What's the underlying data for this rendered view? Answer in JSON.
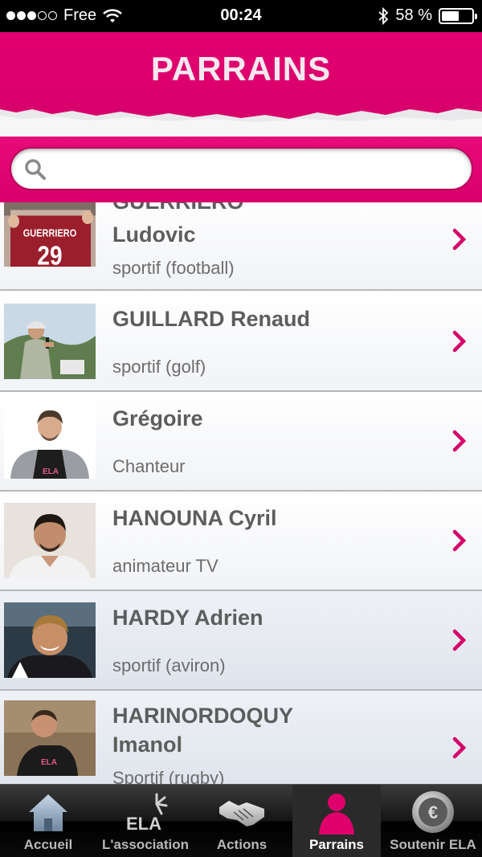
{
  "status_bar": {
    "carrier": "Free",
    "time": "00:24",
    "battery_percent": "58 %",
    "battery_level": 0.58,
    "signal_bars_filled": 3,
    "signal_bars_total": 5
  },
  "header": {
    "title": "PARRAINS"
  },
  "search": {
    "placeholder": "",
    "value": ""
  },
  "list": {
    "items": [
      {
        "name_line1": "GUERRIERO",
        "name_line2": "Ludovic",
        "subtitle": "sportif (football)"
      },
      {
        "name_line1": "GUILLARD  Renaud",
        "subtitle": "sportif (golf)"
      },
      {
        "name_line1": "Grégoire",
        "subtitle": "Chanteur"
      },
      {
        "name_line1": "HANOUNA Cyril",
        "subtitle": "animateur TV"
      },
      {
        "name_line1": "HARDY Adrien",
        "subtitle": "sportif (aviron)"
      },
      {
        "name_line1": "HARINORDOQUY",
        "name_line2": "Imanol",
        "subtitle": "Sportif (rugby)"
      }
    ],
    "photo_texts": {
      "jersey_name": "GUERRIERO",
      "jersey_number": "29",
      "shirt_logo": "ELA"
    }
  },
  "tab_bar": {
    "tabs": [
      {
        "label": "Accueil",
        "icon": "home-icon"
      },
      {
        "label": "L'association",
        "icon": "ela-logo-icon",
        "logo_text": "ELA"
      },
      {
        "label": "Actions",
        "icon": "handshake-icon"
      },
      {
        "label": "Parrains",
        "icon": "person-icon"
      },
      {
        "label": "Soutenir ELA",
        "icon": "euro-coin-icon"
      }
    ],
    "active_index": 3
  },
  "colors": {
    "brand_magenta": "#e3006f",
    "chevron": "#d4006a",
    "text_gray": "#5d5d5d"
  }
}
